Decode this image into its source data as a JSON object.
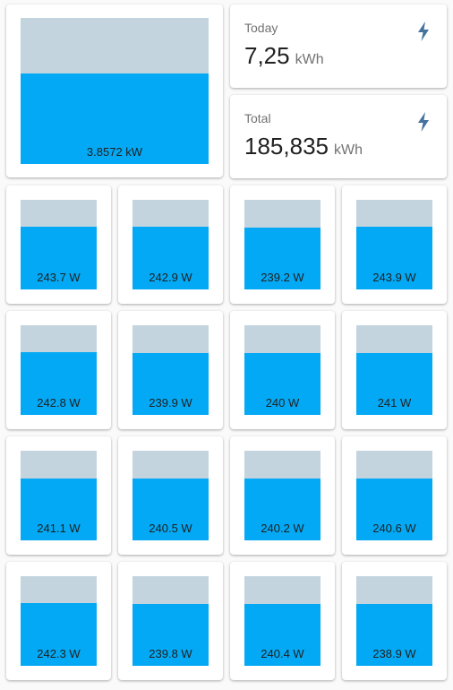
{
  "main_gauge": {
    "label": "3.8572 kW",
    "fraction": 0.62
  },
  "stats": [
    {
      "title": "Today",
      "value": "7,25",
      "unit": "kWh",
      "icon": "flash-icon"
    },
    {
      "title": "Total",
      "value": "185,835",
      "unit": "kWh",
      "icon": "flash-icon"
    }
  ],
  "colors": {
    "fill": "#03a9f4",
    "track": "#c4d4df",
    "icon": "#44739e"
  },
  "panels": [
    {
      "label": "243.7 W",
      "fraction": 0.7
    },
    {
      "label": "242.9 W",
      "fraction": 0.7
    },
    {
      "label": "239.2 W",
      "fraction": 0.69
    },
    {
      "label": "243.9 W",
      "fraction": 0.7
    },
    {
      "label": "242.8 W",
      "fraction": 0.7
    },
    {
      "label": "239.9 W",
      "fraction": 0.69
    },
    {
      "label": "240 W",
      "fraction": 0.69
    },
    {
      "label": "241 W",
      "fraction": 0.69
    },
    {
      "label": "241.1 W",
      "fraction": 0.69
    },
    {
      "label": "240.5 W",
      "fraction": 0.69
    },
    {
      "label": "240.2 W",
      "fraction": 0.69
    },
    {
      "label": "240.6 W",
      "fraction": 0.69
    },
    {
      "label": "242.3 W",
      "fraction": 0.7
    },
    {
      "label": "239.8 W",
      "fraction": 0.69
    },
    {
      "label": "240.4 W",
      "fraction": 0.69
    },
    {
      "label": "238.9 W",
      "fraction": 0.69
    }
  ]
}
